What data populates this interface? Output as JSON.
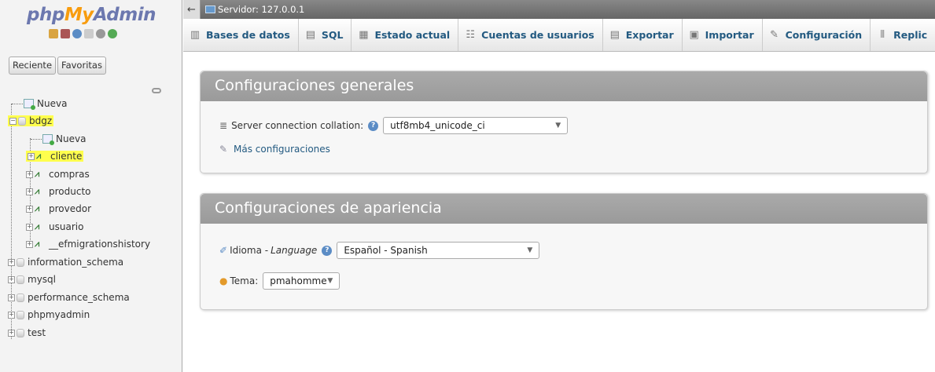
{
  "nav": {
    "logo": {
      "php": "php",
      "my": "My",
      "admin": "Admin"
    },
    "tabs": [
      "Reciente",
      "Favoritas"
    ],
    "tree": [
      {
        "label": "Nueva",
        "type": "new",
        "level": 0,
        "highlight": false
      },
      {
        "label": "bdgz",
        "type": "db",
        "level": 0,
        "highlight": true
      },
      {
        "label": "Nueva",
        "type": "new",
        "level": 1,
        "highlight": false
      },
      {
        "label": "cliente",
        "type": "table",
        "level": 1,
        "highlight": true
      },
      {
        "label": "compras",
        "type": "table",
        "level": 1,
        "highlight": false
      },
      {
        "label": "producto",
        "type": "table",
        "level": 1,
        "highlight": false
      },
      {
        "label": "provedor",
        "type": "table",
        "level": 1,
        "highlight": false
      },
      {
        "label": "usuario",
        "type": "table",
        "level": 1,
        "highlight": false
      },
      {
        "label": "__efmigrationshistory",
        "type": "table",
        "level": 1,
        "highlight": false
      },
      {
        "label": "information_schema",
        "type": "db",
        "level": 0,
        "highlight": false
      },
      {
        "label": "mysql",
        "type": "db",
        "level": 0,
        "highlight": false
      },
      {
        "label": "performance_schema",
        "type": "db",
        "level": 0,
        "highlight": false
      },
      {
        "label": "phpmyadmin",
        "type": "db",
        "level": 0,
        "highlight": false
      },
      {
        "label": "test",
        "type": "db",
        "level": 0,
        "highlight": false
      }
    ]
  },
  "server_bar": {
    "label": "Servidor: 127.0.0.1"
  },
  "top_tabs": [
    {
      "label": "Bases de datos",
      "icon": "database-icon"
    },
    {
      "label": "SQL",
      "icon": "sql-icon"
    },
    {
      "label": "Estado actual",
      "icon": "status-icon"
    },
    {
      "label": "Cuentas de usuarios",
      "icon": "users-icon"
    },
    {
      "label": "Exportar",
      "icon": "export-icon"
    },
    {
      "label": "Importar",
      "icon": "import-icon"
    },
    {
      "label": "Configuración",
      "icon": "wrench-icon"
    },
    {
      "label": "Replic",
      "icon": "replication-icon"
    }
  ],
  "general": {
    "title": "Configuraciones generales",
    "collation_label": "Server connection collation:",
    "collation_value": "utf8mb4_unicode_ci",
    "more_link": "Más configuraciones"
  },
  "appearance": {
    "title": "Configuraciones de apariencia",
    "language_label": "Idioma - ",
    "language_label_italic": "Language",
    "language_value": "Español - Spanish",
    "theme_label": "Tema:",
    "theme_value": "pmahomme"
  },
  "colors": {
    "highlight": "#ffff4d",
    "link": "#235a81",
    "panel_header": "#9a9a9a"
  }
}
